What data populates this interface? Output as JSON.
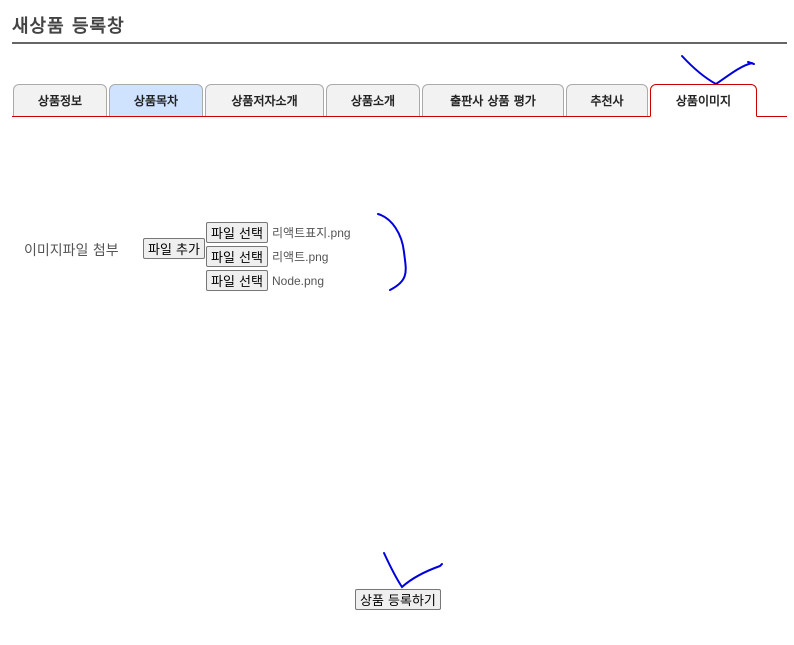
{
  "page": {
    "title": "새상품 등록창"
  },
  "tabs": [
    {
      "label": "상품정보"
    },
    {
      "label": "상품목차"
    },
    {
      "label": "상품저자소개"
    },
    {
      "label": "상품소개"
    },
    {
      "label": "출판사 상품 평가"
    },
    {
      "label": "추천사"
    },
    {
      "label": "상품이미지"
    }
  ],
  "image_section": {
    "label": "이미지파일 첨부",
    "add_button": "파일 추가",
    "files": [
      {
        "button": "파일 선택",
        "filename": "리액트표지.png"
      },
      {
        "button": "파일 선택",
        "filename": "리액트.png"
      },
      {
        "button": "파일 선택",
        "filename": "Node.png"
      }
    ]
  },
  "submit_button": "상품 등록하기",
  "colors": {
    "active_tab_border": "#cc0000",
    "highlight_tab": "#cfe3ff",
    "annotation_ink": "#0000dd"
  }
}
